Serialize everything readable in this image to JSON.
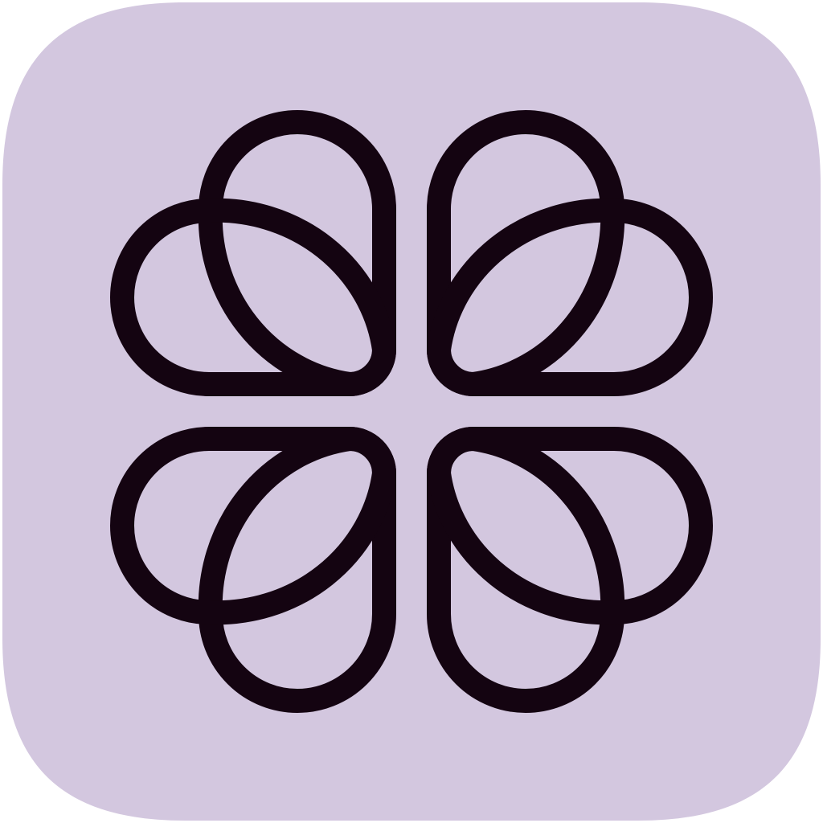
{
  "icon": {
    "name": "clover-flower-icon",
    "background_color": "#D3C7DF",
    "stroke_color": "#140411"
  }
}
